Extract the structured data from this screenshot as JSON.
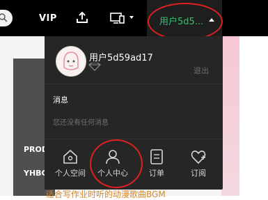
{
  "header": {
    "vip_label": "VIP",
    "user_label": "用户5d5...",
    "accent_color": "#2ec46d"
  },
  "icons": {
    "search": "search-icon",
    "upload": "upload-icon",
    "device": "device-icon",
    "caret_up": "caret-up-icon"
  },
  "dropdown": {
    "username": "用户5d59ad17",
    "logout_label": "退出",
    "messages_title": "消息",
    "messages_empty": "您还没有任何消息",
    "nav": [
      {
        "label": "个人空间",
        "icon": "home-icon"
      },
      {
        "label": "个人中心",
        "icon": "user-icon"
      },
      {
        "label": "订单",
        "icon": "order-icon"
      },
      {
        "label": "订阅",
        "icon": "subscribe-heart-icon"
      }
    ]
  },
  "background": {
    "text1": "PROD",
    "text2": "YHBC",
    "text3": "适合写作业时听的动漫歌曲BGM"
  }
}
